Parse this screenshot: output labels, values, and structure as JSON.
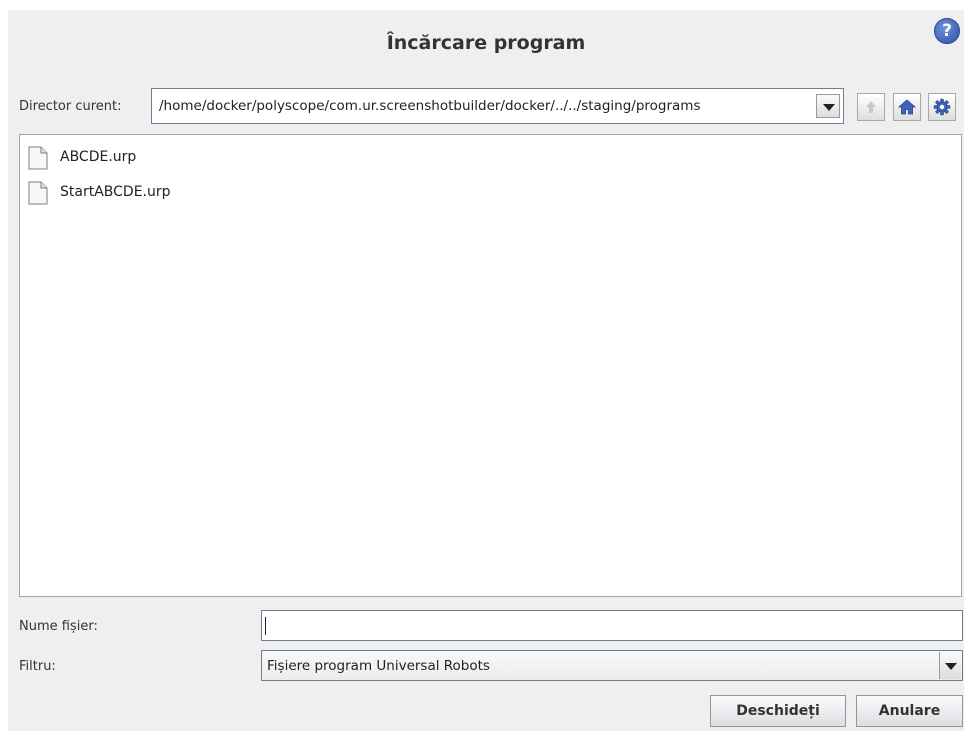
{
  "dialog": {
    "title": "Încărcare program",
    "help_symbol": "?"
  },
  "directory": {
    "label": "Director curent:",
    "path": "/home/docker/polyscope/com.ur.screenshotbuilder/docker/../../staging/programs"
  },
  "toolbar": {
    "up_icon": "arrow-up-icon",
    "home_icon": "home-icon",
    "settings_icon": "gear-icon"
  },
  "files": [
    {
      "name": "ABCDE.urp",
      "icon": "file-icon"
    },
    {
      "name": "StartABCDE.urp",
      "icon": "file-icon"
    }
  ],
  "filename": {
    "label": "Nume fișier:",
    "value": ""
  },
  "filter": {
    "label": "Filtru:",
    "selected": "Fișiere program Universal Robots"
  },
  "buttons": {
    "open": "Deschideți",
    "cancel": "Anulare"
  },
  "colors": {
    "accent": "#2e54a8",
    "background": "#efefef"
  }
}
